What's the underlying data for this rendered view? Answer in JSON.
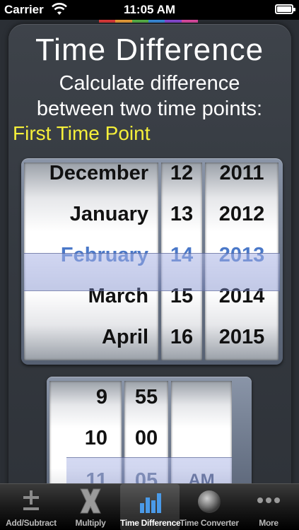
{
  "status_bar": {
    "carrier": "Carrier",
    "time": "11:05 AM",
    "battery_level": 1.0
  },
  "colors": {
    "strip": [
      "#e33b3b",
      "#f0a23a",
      "#5bb74a",
      "#3a8fe0",
      "#8a4bd8",
      "#e24da5"
    ],
    "section_heading": "#f5ef3a",
    "selected_value": "#4a78c8"
  },
  "header": {
    "title": "Time Difference",
    "subtitle_line1": "Calculate difference",
    "subtitle_line2": "between two time points:",
    "section": "First Time Point"
  },
  "date_picker": {
    "months": [
      "December",
      "January",
      "February",
      "March",
      "April"
    ],
    "days": [
      "12",
      "13",
      "14",
      "15",
      "16"
    ],
    "years": [
      "2011",
      "2012",
      "2013",
      "2014",
      "2015"
    ],
    "selected": {
      "month": "February",
      "day": "14",
      "year": "2013"
    }
  },
  "time_picker": {
    "hours": [
      "9",
      "10",
      "11"
    ],
    "minutes": [
      "55",
      "00",
      "05"
    ],
    "ampm": [
      "",
      "",
      "AM"
    ],
    "selected": {
      "hour": "11",
      "minute": "05",
      "ampm": "AM"
    }
  },
  "tabs": [
    {
      "label": "Add/Subtract",
      "icon": "plus-minus-icon",
      "active": false
    },
    {
      "label": "Multiply",
      "icon": "multiply-icon",
      "active": false
    },
    {
      "label": "Time Difference",
      "icon": "bar-chart-icon",
      "active": true
    },
    {
      "label": "Time Converter",
      "icon": "sphere-icon",
      "active": false
    },
    {
      "label": "More",
      "icon": "more-dots-icon",
      "active": false
    }
  ]
}
